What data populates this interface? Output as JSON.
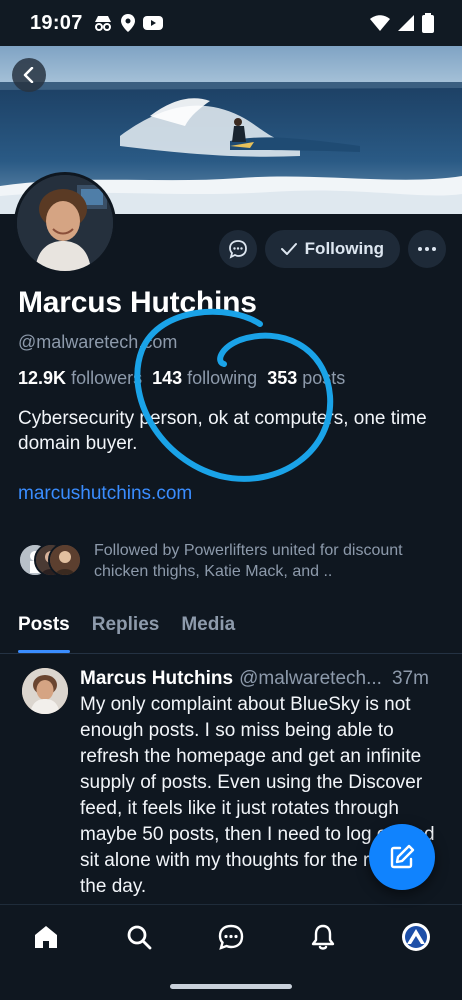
{
  "status_bar": {
    "time": "19:07",
    "left_icons": [
      "incognito-icon",
      "location-icon",
      "youtube-icon"
    ],
    "right_icons": [
      "wifi-icon",
      "signal-icon",
      "battery-icon"
    ]
  },
  "header": {
    "back_icon": "chevron-left-icon",
    "banner": "surf-wave-image"
  },
  "actions": {
    "message_icon": "chat-bubble-icon",
    "follow_label": "Following",
    "follow_icon": "check-icon",
    "more_icon": "ellipsis-icon"
  },
  "profile": {
    "display_name": "Marcus Hutchins",
    "handle": "@malwaretech.com",
    "followers_count": "12.9K",
    "followers_label": "followers",
    "following_count": "143",
    "following_label": "following",
    "posts_count": "353",
    "posts_label": "posts",
    "bio": "Cybersecurity person, ok at computers, one time domain buyer.",
    "website": "marcushutchins.com",
    "followed_by": "Followed by Powerlifters united for discount chicken thighs, Katie Mack, and .."
  },
  "tabs": [
    {
      "label": "Posts",
      "active": true
    },
    {
      "label": "Replies",
      "active": false
    },
    {
      "label": "Media",
      "active": false
    }
  ],
  "post": {
    "author": "Marcus Hutchins",
    "handle": "@malwaretech...",
    "time": "37m",
    "text": "My only complaint about BlueSky is not enough posts. I so miss being able to refresh the homepage and get an infinite supply of posts. Even using the Discover feed, it feels like it just rotates through maybe 50 posts, then I need to log off and sit alone with my thoughts for the rest of the day."
  },
  "fab": {
    "icon": "compose-icon"
  },
  "bottom_nav": [
    {
      "icon": "home-icon"
    },
    {
      "icon": "search-icon"
    },
    {
      "icon": "chat-icon"
    },
    {
      "icon": "bell-icon"
    },
    {
      "icon": "profile-avatar-icon"
    }
  ],
  "colors": {
    "background": "#0f1720",
    "accent": "#3a8dff",
    "fab": "#1083fe",
    "muted_text": "#8d9aab",
    "annotation": "#1aa3e8"
  }
}
